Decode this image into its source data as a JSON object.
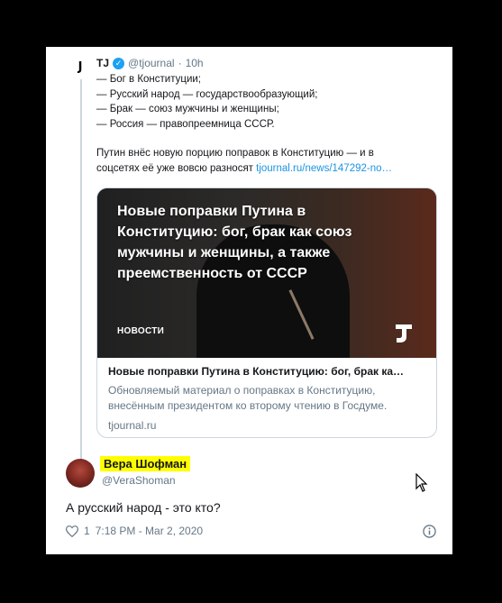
{
  "quoted": {
    "avatar_letter": "J",
    "name": "TJ",
    "handle": "@tjournal",
    "separator": "·",
    "time": "10h",
    "lines": [
      "— Бог в Конституции;",
      "— Русский народ — государствообразующий;",
      "— Брак — союз мужчины и женщины;",
      "— Россия — правопреемница СССР."
    ],
    "para_line1": "Путин внёс новую порцию поправок в Конституцию — и в",
    "para_line2_text": "соцсетях её уже вовсю разносят ",
    "para_link": "tjournal.ru/news/147292-no…"
  },
  "link_card": {
    "image_title": "Новые поправки Путина в Конституцию: бог, брак как союз мужчины и женщины, а также преемственность от СССР",
    "category": "НОВОСТИ",
    "headline": "Новые поправки Путина в Конституцию: бог, брак ка…",
    "description": "Обновляемый материал о поправках в Конституцию, внесённым президентом ко второму чтению в Госдуме.",
    "source": "tjournal.ru"
  },
  "user": {
    "name": "Вера Шофман",
    "handle": "@VeraShoman"
  },
  "reply_text": "А русский народ - это кто?",
  "meta": {
    "likes": "1",
    "timestamp": "7:18 PM - Mar 2, 2020"
  },
  "colors": {
    "link": "#1b95e0",
    "muted": "#657786",
    "highlight": "#ffff00",
    "verified": "#1da1f2"
  },
  "icons": [
    "verified-badge-icon",
    "tj-logo-icon",
    "heart-icon",
    "info-icon",
    "mouse-cursor-icon"
  ]
}
